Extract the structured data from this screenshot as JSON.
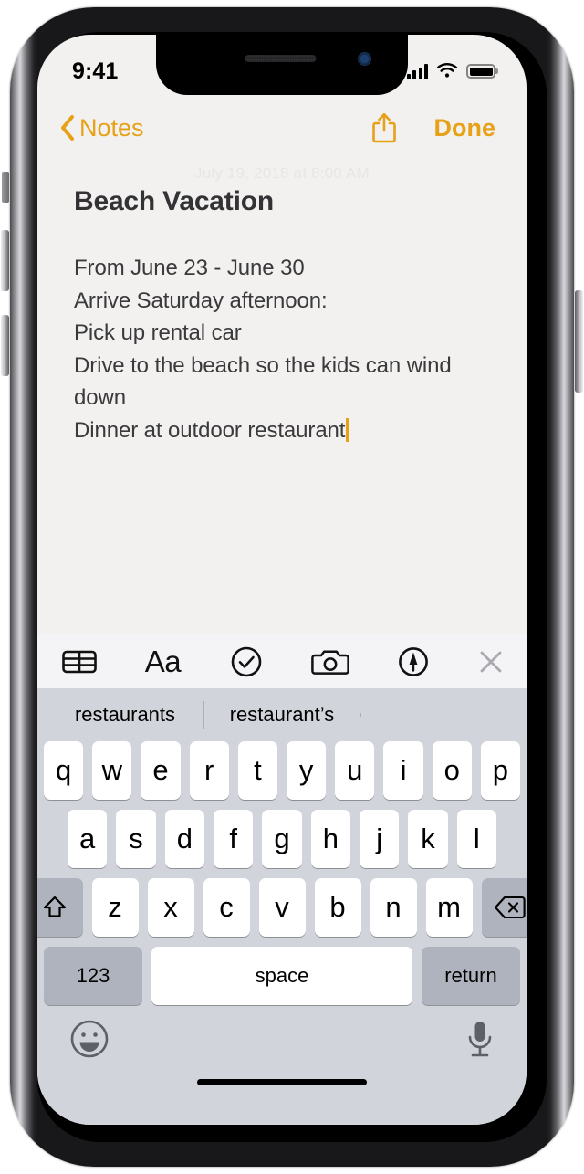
{
  "status_bar": {
    "time": "9:41",
    "signal_icon": "cellular-signal-icon",
    "wifi_icon": "wifi-icon",
    "battery_icon": "battery-full-icon"
  },
  "nav_bar": {
    "back_label": "Notes",
    "back_icon": "chevron-left-icon",
    "share_icon": "share-icon",
    "done_label": "Done",
    "accent_color": "#e6a117"
  },
  "note": {
    "timestamp": "July 19, 2018 at 8:00 AM",
    "title": "Beach Vacation",
    "lines": [
      "From June 23 - June 30",
      "Arrive Saturday afternoon:",
      "Pick up rental car",
      "Drive to the beach so the kids can wind down",
      "Dinner at outdoor restaurant"
    ],
    "body": "From June 23 - June 30\nArrive Saturday afternoon:\nPick up rental car\nDrive to the beach so the kids can wind down\nDinner at outdoor restaurant",
    "cursor_color": "#e6a117",
    "paper_color": "#f3f2f0",
    "text_color": "#3a3a3c"
  },
  "notes_toolbar": {
    "items": [
      {
        "name": "table-icon",
        "label": ""
      },
      {
        "name": "format-aa-icon",
        "label": "Aa"
      },
      {
        "name": "checklist-icon",
        "label": ""
      },
      {
        "name": "camera-icon",
        "label": ""
      },
      {
        "name": "markup-pen-icon",
        "label": ""
      }
    ],
    "close_icon": "close-icon",
    "background_color": "#f4f4f6"
  },
  "keyboard": {
    "background_color": "#d1d4da",
    "key_color": "#ffffff",
    "modifier_key_color": "#aeb3bd",
    "suggestions": [
      "restaurants",
      "restaurant’s",
      ""
    ],
    "row_1": [
      "q",
      "w",
      "e",
      "r",
      "t",
      "y",
      "u",
      "i",
      "o",
      "p"
    ],
    "row_2": [
      "a",
      "s",
      "d",
      "f",
      "g",
      "h",
      "j",
      "k",
      "l"
    ],
    "row_3_letters": [
      "z",
      "x",
      "c",
      "v",
      "b",
      "n",
      "m"
    ],
    "shift_icon": "shift-icon",
    "backspace_icon": "backspace-icon",
    "numbers_label": "123",
    "space_label": "space",
    "return_label": "return",
    "emoji_icon": "emoji-smiley-icon",
    "dictation_icon": "microphone-icon"
  }
}
